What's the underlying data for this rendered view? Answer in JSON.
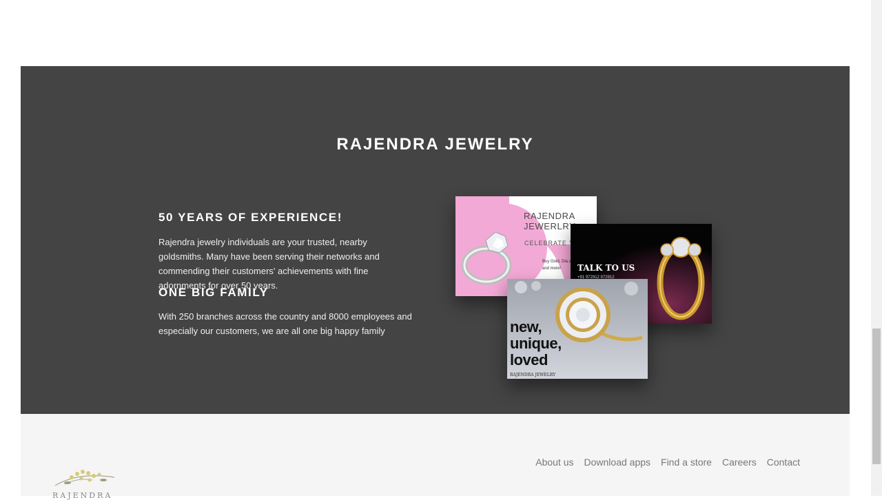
{
  "brand": {
    "title": "RAJENDRA JEWELRY"
  },
  "features": [
    {
      "heading": "50 YEARS OF EXPERIENCE!",
      "text": "Rajendra jewelry individuals are your trusted, nearby goldsmiths. Many have been serving their networks and commending their customers' achievements with fine adornments for over 50 years."
    },
    {
      "heading": "ONE BIG FAMILY",
      "text": "With 250 branches across the country and 8000 employees and especially our customers, we are all one big happy family"
    }
  ],
  "cards": {
    "card1": {
      "brand": "RAJENDRA JEWERLRY",
      "subtitle": "CELEBRATE YO",
      "small_text": "Buy Gold, Dia and Silver jew and more!"
    },
    "card2": {
      "title": "TALK TO US",
      "phone": "+91 972912 972912"
    },
    "card3": {
      "tagline": "new, unique, loved",
      "footer": "RAJENDRA JEWELRY"
    }
  },
  "footer": {
    "nav": [
      "About us",
      "Download apps",
      "Find a store",
      "Careers",
      "Contact"
    ],
    "logo_text": "RAJENDRA"
  },
  "colors": {
    "dark_section": "#444444",
    "footer_bg": "#f5f5f5",
    "pink": "#f3a9d6",
    "gold": "#c9972e"
  }
}
